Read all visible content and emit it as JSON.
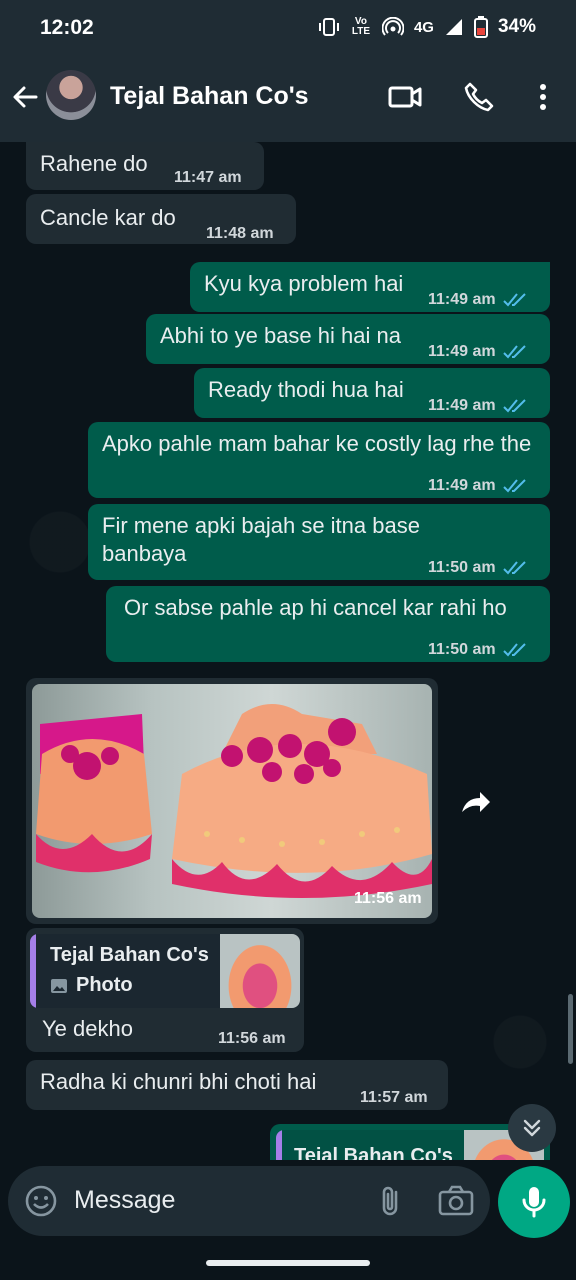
{
  "status_bar": {
    "time": "12:02",
    "network": "4G",
    "volte": "Vo LTE",
    "battery": "34%"
  },
  "header": {
    "contact_name": "Tejal Bahan Co's"
  },
  "messages": [
    {
      "dir": "in",
      "text": "Rahene do",
      "time": "11:47 am"
    },
    {
      "dir": "in",
      "text": "Cancle kar do",
      "time": "11:48 am"
    },
    {
      "dir": "out",
      "text": "Kyu kya problem hai",
      "time": "11:49 am"
    },
    {
      "dir": "out",
      "text": "Abhi to ye base hi hai na",
      "time": "11:49 am"
    },
    {
      "dir": "out",
      "text": "Ready thodi hua hai",
      "time": "11:49 am"
    },
    {
      "dir": "out",
      "text": "Apko pahle mam bahar ke costly lag rhe the",
      "time": "11:49 am"
    },
    {
      "dir": "out",
      "text": "Fir mene apki bajah se itna base banbaya",
      "time": "11:50 am"
    },
    {
      "dir": "out",
      "text": "Or sabse pahle ap hi cancel kar rahi ho",
      "time": "11:50 am"
    }
  ],
  "photo_message": {
    "time": "11:56 am"
  },
  "reply_message": {
    "quoted_name": "Tejal Bahan Co's",
    "quoted_type": "Photo",
    "text": "Ye dekho",
    "time": "11:56 am"
  },
  "last_in": {
    "text": "Radha ki chunri bhi choti hai",
    "time": "11:57 am"
  },
  "partial_out": {
    "quoted_name": "Tejal Bahan Co's"
  },
  "composer": {
    "placeholder": "Message"
  },
  "colors": {
    "incoming": "#202c33",
    "outgoing": "#005c4b",
    "accent": "#00a884",
    "read_tick": "#53bdeb"
  }
}
